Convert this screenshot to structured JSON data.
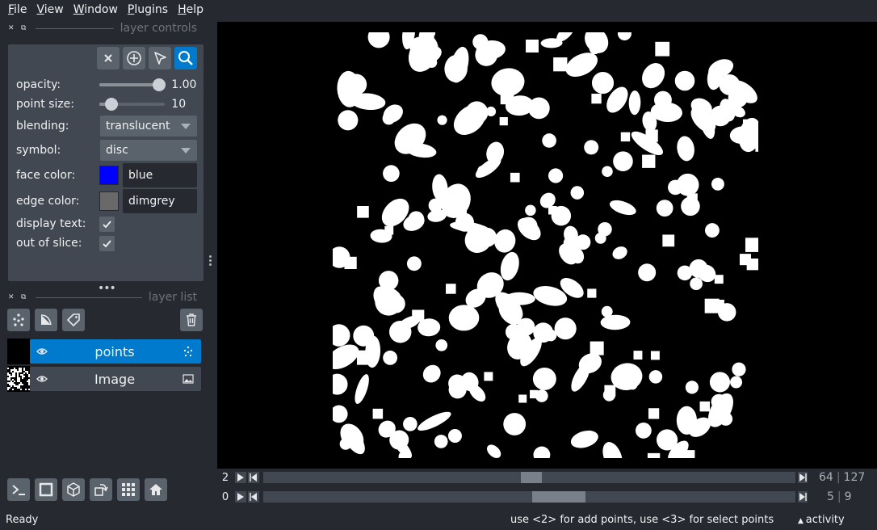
{
  "menu": [
    {
      "id": "file",
      "label": "File"
    },
    {
      "id": "view",
      "label": "View"
    },
    {
      "id": "window",
      "label": "Window"
    },
    {
      "id": "plugins",
      "label": "Plugins"
    },
    {
      "id": "help",
      "label": "Help"
    }
  ],
  "docks": {
    "controls_title": "layer controls",
    "list_title": "layer list"
  },
  "controls": {
    "opacity_label": "opacity:",
    "opacity_value": "1.00",
    "opacity_fraction": 1.0,
    "point_size_label": "point size:",
    "point_size_value": "10",
    "point_size_fraction": 0.1,
    "blending_label": "blending:",
    "blending_value": "translucent",
    "symbol_label": "symbol:",
    "symbol_value": "disc",
    "face_color_label": "face color:",
    "face_color_value": "blue",
    "face_color_hex": "#0000ff",
    "edge_color_label": "edge color:",
    "edge_color_value": "dimgrey",
    "edge_color_hex": "#696969",
    "display_text_label": "display text:",
    "display_text_checked": true,
    "out_of_slice_label": "out of slice:",
    "out_of_slice_checked": true
  },
  "layers": [
    {
      "name": "points",
      "type_icon": "points-icon",
      "selected": true,
      "visible": true
    },
    {
      "name": "Image",
      "type_icon": "image-icon",
      "selected": false,
      "visible": true
    }
  ],
  "dims": [
    {
      "axis": "2",
      "current": "64",
      "total": "127",
      "fraction": 0.504
    },
    {
      "axis": "0",
      "current": "5",
      "total": "9",
      "fraction": 0.555
    }
  ],
  "status": {
    "left": "Ready",
    "hint": "use <2> for add points, use <3> for select points",
    "activity": "activity"
  },
  "colors": {
    "accent": "#007acc",
    "background": "#262930",
    "panel": "#414851"
  }
}
